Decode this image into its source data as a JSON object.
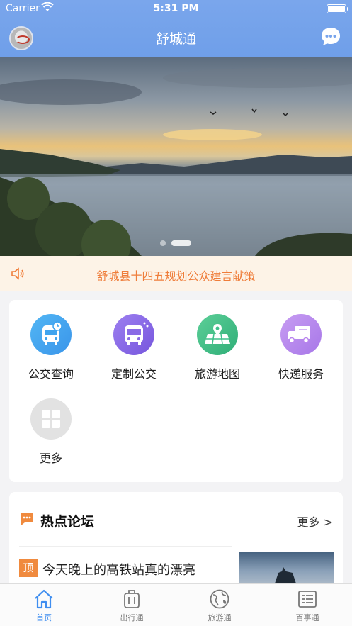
{
  "status_bar": {
    "carrier": "Carrier",
    "time": "5:31 PM"
  },
  "nav": {
    "title": "舒城通"
  },
  "banner": {
    "slide_count": 2,
    "active_slide": 2
  },
  "notice": {
    "text": "舒城县十四五规划公众建言献策"
  },
  "services": [
    {
      "label": "公交查询",
      "icon": "bus-query-icon",
      "color": "#3fa4ef"
    },
    {
      "label": "定制公交",
      "icon": "custom-bus-icon",
      "color": "#8a6ae6"
    },
    {
      "label": "旅游地图",
      "icon": "travel-map-icon",
      "color": "#3ec08a"
    },
    {
      "label": "快递服务",
      "icon": "delivery-truck-icon",
      "color": "#b985ee"
    },
    {
      "label": "更多",
      "icon": "more-grid-icon",
      "color": "#d8d8d8"
    }
  ],
  "forum": {
    "title": "热点论坛",
    "more": "更多 >",
    "posts": [
      {
        "tag": "顶",
        "title": "今天晚上的高铁站真的漂亮"
      }
    ]
  },
  "tabs": [
    {
      "label": "首页",
      "icon": "home-icon",
      "active": true
    },
    {
      "label": "出行通",
      "icon": "luggage-icon",
      "active": false
    },
    {
      "label": "旅游通",
      "icon": "globe-icon",
      "active": false
    },
    {
      "label": "百事通",
      "icon": "news-list-icon",
      "active": false
    }
  ],
  "colors": {
    "nav_bar": "#78a4ec",
    "accent_orange": "#ef7d3a",
    "tab_active": "#3f8ef0"
  }
}
